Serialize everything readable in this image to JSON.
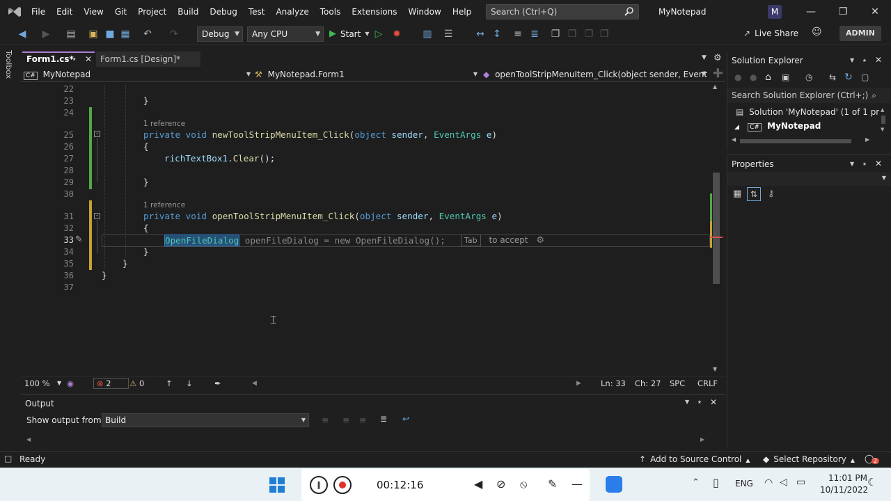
{
  "menu": {
    "items": [
      "File",
      "Edit",
      "View",
      "Git",
      "Project",
      "Build",
      "Debug",
      "Test",
      "Analyze",
      "Tools",
      "Extensions",
      "Window",
      "Help"
    ],
    "search_placeholder": "Search (Ctrl+Q)",
    "app_title": "MyNotepad",
    "avatar_initial": "M"
  },
  "toolbar": {
    "config": "Debug",
    "platform": "Any CPU",
    "start": "Start",
    "live_share": "Live Share",
    "admin": "ADMIN"
  },
  "toolbox": {
    "label": "Toolbox"
  },
  "editor": {
    "tabs": [
      {
        "label": "Form1.cs*",
        "active": true
      },
      {
        "label": "Form1.cs [Design]*",
        "active": false
      }
    ],
    "nav": {
      "project": "MyNotepad",
      "class": "MyNotepad.Form1",
      "member": "openToolStripMenuItem_Click(object sender, EventArgs e)"
    },
    "line_numbers": [
      "22",
      "23",
      "24",
      "25",
      "26",
      "27",
      "28",
      "29",
      "30",
      "31",
      "32",
      "33",
      "34",
      "35",
      "36",
      "37"
    ],
    "code": {
      "l23": "}",
      "ref1": "1 reference",
      "l25_kw": "private void ",
      "l25_fn": "newToolStripMenuItem_Click",
      "l25_rest1": "(",
      "l25_ty1": "object",
      "l25_p1": " sender",
      "l25_rest2": ", ",
      "l25_ty2": "EventArgs",
      "l25_p2": " e",
      "l25_rest3": ")",
      "l26": "{",
      "l27_a": "richTextBox1",
      "l27_b": ".",
      "l27_c": "Clear",
      "l27_d": "();",
      "l29": "}",
      "ref2": "1 reference",
      "l31_kw": "private void ",
      "l31_fn": "openToolStripMenuItem_Click",
      "l31_rest1": "(",
      "l31_ty1": "object",
      "l31_p1": " sender",
      "l31_rest2": ", ",
      "l31_ty2": "EventArgs",
      "l31_p2": " e",
      "l31_rest3": ")",
      "l32": "{",
      "l33_typed": "OpenFileDialog",
      "l33_ghost": " openFileDialog = new OpenFileDialog();",
      "l33_tab": "Tab",
      "l33_accept": "to accept",
      "l34": "}",
      "l35": "}",
      "l36": "}"
    },
    "status": {
      "zoom": "100 %",
      "errors": "2",
      "warnings": "0",
      "line": "Ln: 33",
      "char": "Ch: 27",
      "spc": "SPC",
      "eol": "CRLF"
    }
  },
  "output": {
    "title": "Output",
    "show_from_label": "Show output from:",
    "source": "Build"
  },
  "solution_explorer": {
    "title": "Solution Explorer",
    "search_placeholder": "Search Solution Explorer (Ctrl+;)",
    "solution": "Solution 'MyNotepad' (1 of 1 pro",
    "project": "MyNotepad"
  },
  "properties": {
    "title": "Properties"
  },
  "statusbar": {
    "ready": "Ready",
    "source_control": "Add to Source Control",
    "repo": "Select Repository",
    "notif_count": "2"
  },
  "taskbar": {
    "timer": "00:12:16",
    "lang": "ENG",
    "time": "11:01 PM",
    "date": "10/11/2022"
  },
  "colors": {
    "keyword": "#569cd6",
    "type": "#4ec9b0",
    "method": "#dcdcaa",
    "accent": "#b180d7",
    "changed": "#57a64a"
  }
}
